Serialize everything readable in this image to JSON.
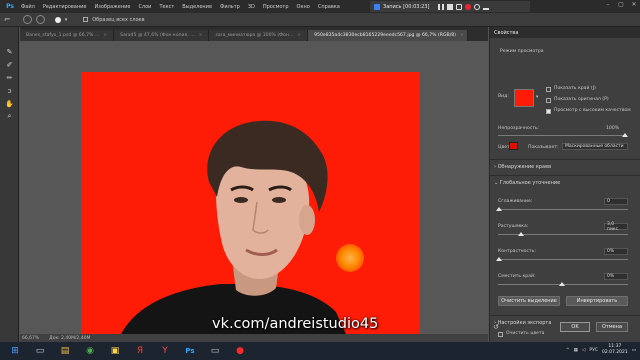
{
  "menu": [
    "Файл",
    "Редактирование",
    "Изображение",
    "Слои",
    "Текст",
    "Выделение",
    "Фильтр",
    "3D",
    "Просмотр",
    "Окно",
    "Справка"
  ],
  "recording": {
    "label": "Запись [00:03:23]"
  },
  "options": {
    "sample_all_layers": "Образец всех слоев"
  },
  "tabs": [
    {
      "label": "Banes_stafyx_1.psd @ 66,7% ..."
    },
    {
      "label": "Sara45 @ 47,6% (Фон копия, ..."
    },
    {
      "label": "sara_миниатюра @ 100% (Фон..."
    },
    {
      "label": "950e835a4c3830ecb8165229eeedc567.jpg @ 66,7% (RGB/8)",
      "active": true
    }
  ],
  "watermark": "vk.com/andreistudio45",
  "status": {
    "zoom": "66,67%",
    "doc": "Док: 2,40M/2,40M"
  },
  "properties": {
    "tab": "Свойства",
    "view_mode_title": "Режим просмотра",
    "view_label": "Вид:",
    "show_edge": "Показать край (J)",
    "show_original": "Показать оригинал (P)",
    "hq_preview": "Просмотр с высоким качеством",
    "opacity_label": "Непрозрачность:",
    "opacity_value": "100%",
    "color_label": "Цвет:",
    "indicates_label": "Показывает:",
    "indicates_value": "Маскированные области",
    "edge_detection": "Обнаружение краев",
    "global_refinement": "Глобальное уточнение",
    "smooth_label": "Сглаживание:",
    "smooth_value": "0",
    "feather_label": "Растушевка:",
    "feather_value": "3,0 пикс.",
    "contrast_label": "Контрастность:",
    "contrast_value": "0%",
    "shift_edge_label": "Сместить край:",
    "shift_edge_value": "0%",
    "clear_selection": "Очистить выделение",
    "invert": "Инвертировать",
    "output_settings": "Настройки экспорта",
    "decontaminate": "Очистить цвета",
    "ok": "OK",
    "cancel": "Отмена"
  },
  "taskbar": {
    "lang": "РУС",
    "time": "11:37",
    "date": "02.07.2021"
  }
}
